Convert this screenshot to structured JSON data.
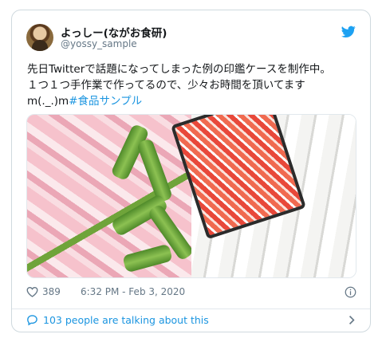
{
  "author": {
    "display_name": "よっしー(ながお食研)",
    "handle": "@yossy_sample"
  },
  "tweet": {
    "line1": "先日Twitterで話題になってしまった例の印鑑ケースを制作中。",
    "line2": "１つ１つ手作業で作ってるので、少々お時間を頂いてます",
    "line3_prefix": "m(._.)m",
    "hashtag": "#食品サンプル"
  },
  "meta": {
    "like_count": "389",
    "timestamp": "6:32 PM - Feb 3, 2020"
  },
  "footer": {
    "talking_text": "103 people are talking about this"
  },
  "colors": {
    "link": "#1b95e0",
    "secondary_text": "#657786",
    "border": "#cfd9de"
  },
  "icons": [
    "twitter-bird-icon",
    "heart-icon",
    "info-icon",
    "speech-bubble-icon",
    "chevron-right-icon"
  ]
}
